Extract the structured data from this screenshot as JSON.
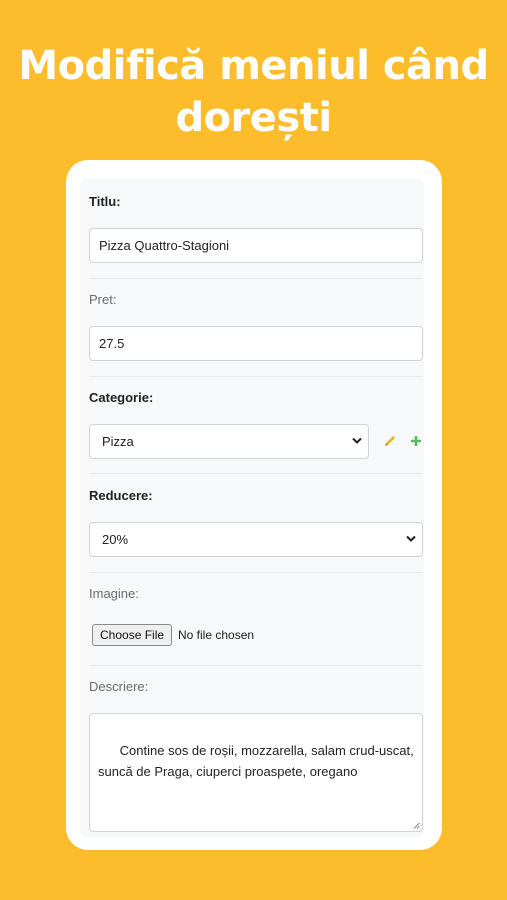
{
  "hero": {
    "line1": "Modifică meniul când",
    "line2": "dorești"
  },
  "form": {
    "title": {
      "label": "Titlu:",
      "value": "Pizza Quattro-Stagioni"
    },
    "price": {
      "label": "Pret:",
      "value": "27.5"
    },
    "category": {
      "label": "Categorie:",
      "selected": "Pizza",
      "edit_icon": "pencil-icon",
      "add_icon": "plus-icon"
    },
    "discount": {
      "label": "Reducere:",
      "selected": "20%"
    },
    "image": {
      "label": "Imagine:",
      "button_label": "Choose File",
      "status": "No file chosen"
    },
    "description": {
      "label": "Descriere:",
      "value": "Contine sos de roșii, mozzarella, salam crud-uscat, suncă de Praga, ciuperci proaspete, oregano"
    }
  },
  "colors": {
    "background": "#FDBC2C",
    "pencil": "#E3B62B",
    "plus": "#5CB85C"
  }
}
